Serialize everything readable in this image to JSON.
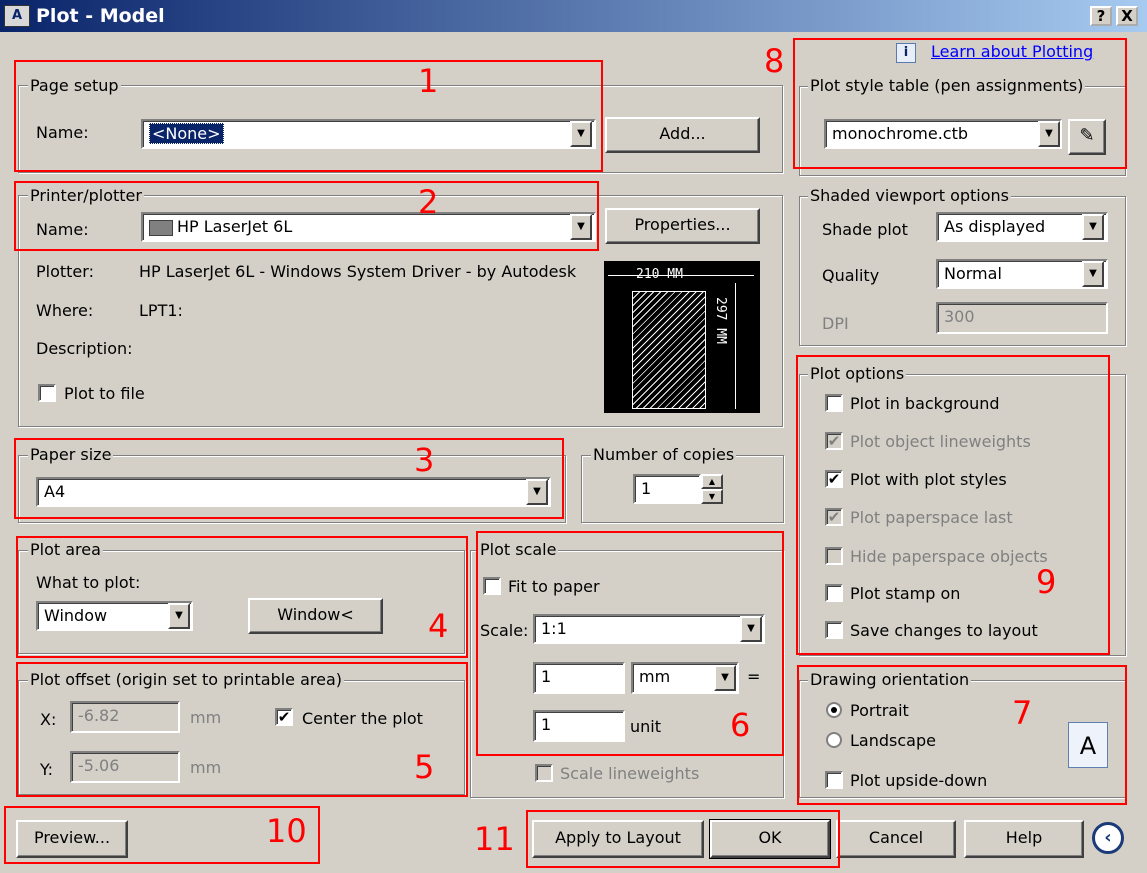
{
  "window": {
    "title": "Plot - Model",
    "app_icon": "autocad-icon",
    "help_button": "?",
    "close_button": "X"
  },
  "learn_link": "Learn about Plotting",
  "page_setup": {
    "legend": "Page setup",
    "name_label": "Name:",
    "name_value": "<None>",
    "add_button": "Add..."
  },
  "printer": {
    "legend": "Printer/plotter",
    "name_label": "Name:",
    "name_value": "HP LaserJet 6L",
    "properties_button": "Properties...",
    "plotter_label": "Plotter:",
    "plotter_value": "HP LaserJet 6L - Windows System Driver - by Autodesk",
    "where_label": "Where:",
    "where_value": "LPT1:",
    "description_label": "Description:",
    "plot_to_file_label": "Plot to file",
    "plot_to_file_checked": false,
    "preview_width": "210 MM",
    "preview_height": "297 MM"
  },
  "paper_size": {
    "legend": "Paper size",
    "value": "A4"
  },
  "copies": {
    "legend": "Number of copies",
    "value": "1"
  },
  "plot_area": {
    "legend": "Plot area",
    "what_label": "What to plot:",
    "what_value": "Window",
    "window_button": "Window<"
  },
  "plot_offset": {
    "legend": "Plot offset (origin set to printable area)",
    "x_label": "X:",
    "x_value": "-6.82",
    "x_unit": "mm",
    "y_label": "Y:",
    "y_value": "-5.06",
    "y_unit": "mm",
    "center_label": "Center the plot",
    "center_checked": true
  },
  "plot_scale": {
    "legend": "Plot scale",
    "fit_label": "Fit to paper",
    "fit_checked": false,
    "scale_label": "Scale:",
    "scale_value": "1:1",
    "num_value": "1",
    "unit_value": "mm",
    "equals": "=",
    "den_value": "1",
    "den_unit": "unit",
    "lineweights_label": "Scale lineweights"
  },
  "plot_style": {
    "legend": "Plot style table (pen assignments)",
    "value": "monochrome.ctb",
    "edit_icon": "pencil-edit-icon"
  },
  "shaded": {
    "legend": "Shaded viewport options",
    "shade_label": "Shade plot",
    "shade_value": "As displayed",
    "quality_label": "Quality",
    "quality_value": "Normal",
    "dpi_label": "DPI",
    "dpi_value": "300"
  },
  "plot_options": {
    "legend": "Plot options",
    "items": [
      {
        "label": "Plot in background",
        "checked": false,
        "enabled": true
      },
      {
        "label": "Plot object lineweights",
        "checked": true,
        "enabled": false
      },
      {
        "label": "Plot with plot styles",
        "checked": true,
        "enabled": true
      },
      {
        "label": "Plot paperspace last",
        "checked": true,
        "enabled": false
      },
      {
        "label": "Hide paperspace objects",
        "checked": false,
        "enabled": false
      },
      {
        "label": "Plot stamp on",
        "checked": false,
        "enabled": true
      },
      {
        "label": "Save changes to layout",
        "checked": false,
        "enabled": true
      }
    ]
  },
  "orientation": {
    "legend": "Drawing orientation",
    "portrait": "Portrait",
    "landscape": "Landscape",
    "upside_down": "Plot upside-down",
    "icon_letter": "A"
  },
  "footer": {
    "preview": "Preview...",
    "apply": "Apply to Layout",
    "ok": "OK",
    "cancel": "Cancel",
    "help": "Help",
    "more_icon": "chevron-left-circle-icon"
  },
  "annotations": [
    "1",
    "2",
    "3",
    "4",
    "5",
    "6",
    "7",
    "8",
    "9",
    "10",
    "11"
  ],
  "colors": {
    "dialog": "#d4d0c8",
    "title_start": "#0a246a",
    "title_end": "#a6caf0",
    "annotation": "#ff0000",
    "selection": "#0a246a",
    "link": "#0000ff"
  }
}
